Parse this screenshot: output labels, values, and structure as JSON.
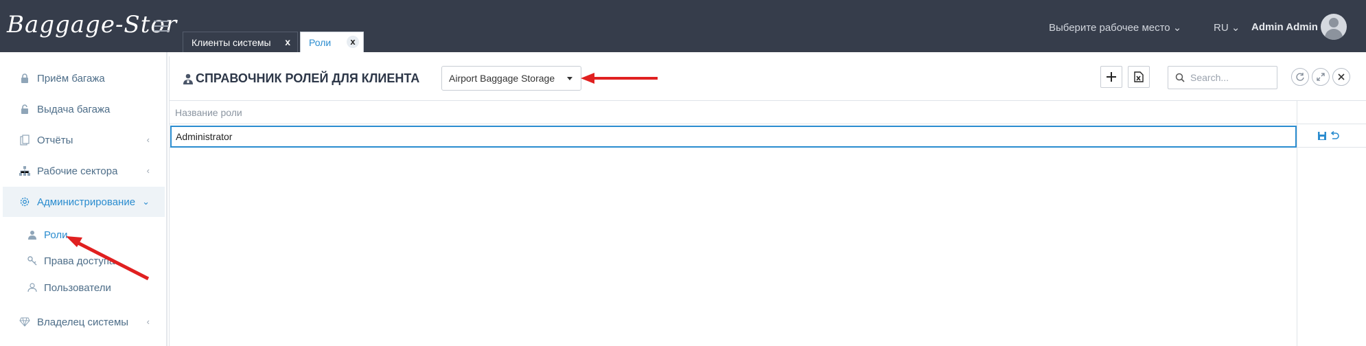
{
  "header": {
    "logo": "Baggage-Stor",
    "tabs": [
      {
        "label": "Клиенты системы",
        "close": "x"
      },
      {
        "label": "Роли",
        "close": "x"
      }
    ],
    "workplace": "Выберите рабочее место ⌄",
    "lang": "RU ⌄",
    "user": "Admin Admin"
  },
  "sidebar": {
    "items": [
      {
        "label": "Приём багажа",
        "icon": "lock-icon"
      },
      {
        "label": "Выдача багажа",
        "icon": "unlock-icon"
      },
      {
        "label": "Отчёты",
        "icon": "reports-icon",
        "chevron": "‹"
      },
      {
        "label": "Рабочие сектора",
        "icon": "sitemap-icon",
        "chevron": "‹"
      },
      {
        "label": "Администрирование",
        "icon": "gear-icon",
        "chevron": "⌄"
      },
      {
        "label": "Владелец системы",
        "icon": "diamond-icon",
        "chevron": "‹"
      }
    ],
    "subitems": [
      {
        "label": "Роли",
        "icon": "user-role-icon"
      },
      {
        "label": "Права доступа",
        "icon": "key-icon"
      },
      {
        "label": "Пользователи",
        "icon": "user-icon"
      }
    ]
  },
  "main": {
    "title": "СПРАВОЧНИК РОЛЕЙ ДЛЯ КЛИЕНТА",
    "client_select": "Airport Baggage Storage",
    "search_placeholder": "Search...",
    "grid": {
      "columns": [
        "Название роли"
      ],
      "rows": [
        {
          "name": "Administrator"
        }
      ]
    }
  },
  "colors": {
    "header_bg": "#363d4b",
    "accent": "#2a8ccf",
    "annotation_arrow": "#e02020"
  }
}
